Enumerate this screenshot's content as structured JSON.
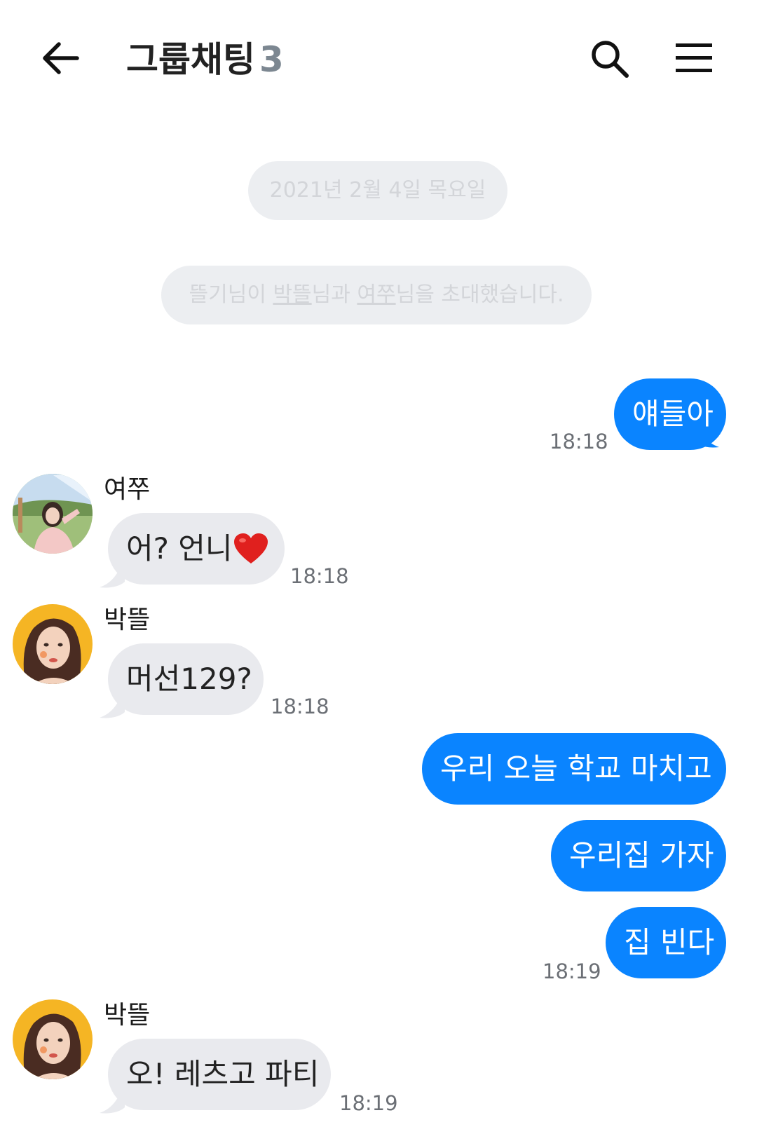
{
  "header": {
    "title": "그룹채팅",
    "member_count": "3",
    "back_icon": "arrow-left-icon",
    "search_icon": "search-icon",
    "menu_icon": "hamburger-menu-icon"
  },
  "system": {
    "date": "2021년 2월 4일 목요일",
    "invite_prefix": "뜰기님이 ",
    "invite_user1": "박뜰",
    "invite_mid": "님과 ",
    "invite_user2": "여쭈",
    "invite_suffix": "님을 초대했습니다."
  },
  "messages": [
    {
      "text": "얘들아",
      "time": "18:18"
    },
    {
      "sender": "여쭈",
      "text": "어? 언니",
      "emoji": "heart",
      "time": "18:18"
    },
    {
      "sender": "박뜰",
      "text": "머선129?",
      "time": "18:18"
    },
    {
      "text": "우리 오늘 학교 마치고"
    },
    {
      "text": "우리집 가자"
    },
    {
      "text": "집 빈다",
      "time": "18:19"
    },
    {
      "sender": "박뜰",
      "text": "오! 레츠고 파티",
      "time": "18:19"
    }
  ],
  "colors": {
    "outgoing_bubble": "#0a84ff",
    "incoming_bubble": "#e9eaee",
    "system_pill": "#eceef1",
    "count_gray": "#7c8791"
  }
}
